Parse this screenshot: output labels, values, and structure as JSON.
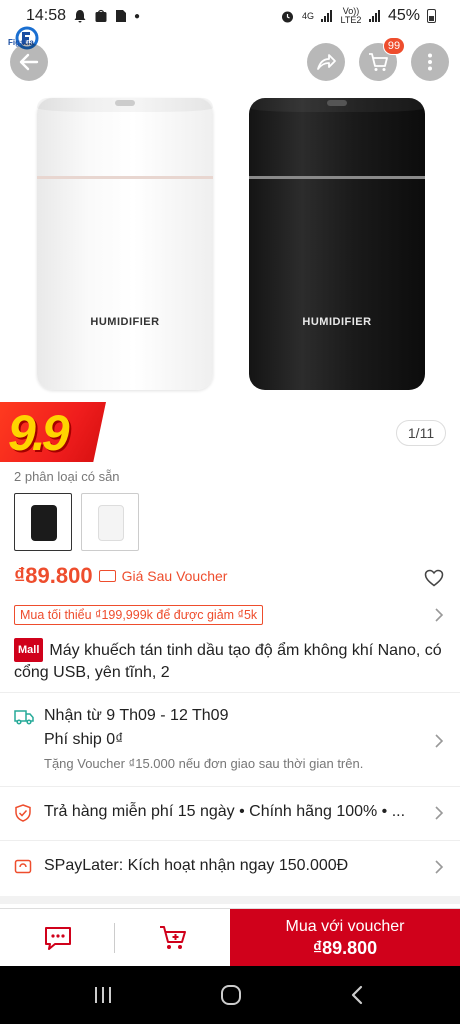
{
  "status_bar": {
    "time": "14:58",
    "network_top": "4G",
    "volte": "Vo)) LTE2",
    "battery": "45%"
  },
  "header": {
    "logo_text": "Figatia",
    "cart_count": "99"
  },
  "gallery": {
    "brand_text": "HUMIDIFIER",
    "promo_label": "9.9",
    "pager": "1/11"
  },
  "variants": {
    "label": "2 phân loại có sẵn"
  },
  "price": {
    "amount": "₫89.800",
    "voucher_label": "Giá Sau Voucher",
    "min_spend": "Mua tối thiểu ₫199,999k để được giảm ₫5k"
  },
  "product": {
    "mall_tag": "Mall",
    "title": "Máy khuếch tán tinh dầu tạo độ ẩm không khí Nano, có cổng USB, yên tĩnh, 2"
  },
  "shipping": {
    "delivery": "Nhận từ 9 Th09 - 12 Th09",
    "fee": "Phí ship 0₫",
    "note": "Tặng Voucher ₫15.000 nếu đơn giao sau thời gian trên."
  },
  "guarantee": {
    "text": "Trả hàng miễn phí 15 ngày • Chính hãng 100% • ..."
  },
  "spaylater": {
    "text": "SPayLater: Kích hoạt nhận ngay 150.000Đ"
  },
  "bottom_bar": {
    "buy_label": "Mua với voucher",
    "buy_price": "₫89.800"
  },
  "colors": {
    "accent": "#ee4d2d",
    "buy_button": "#d0011b"
  }
}
